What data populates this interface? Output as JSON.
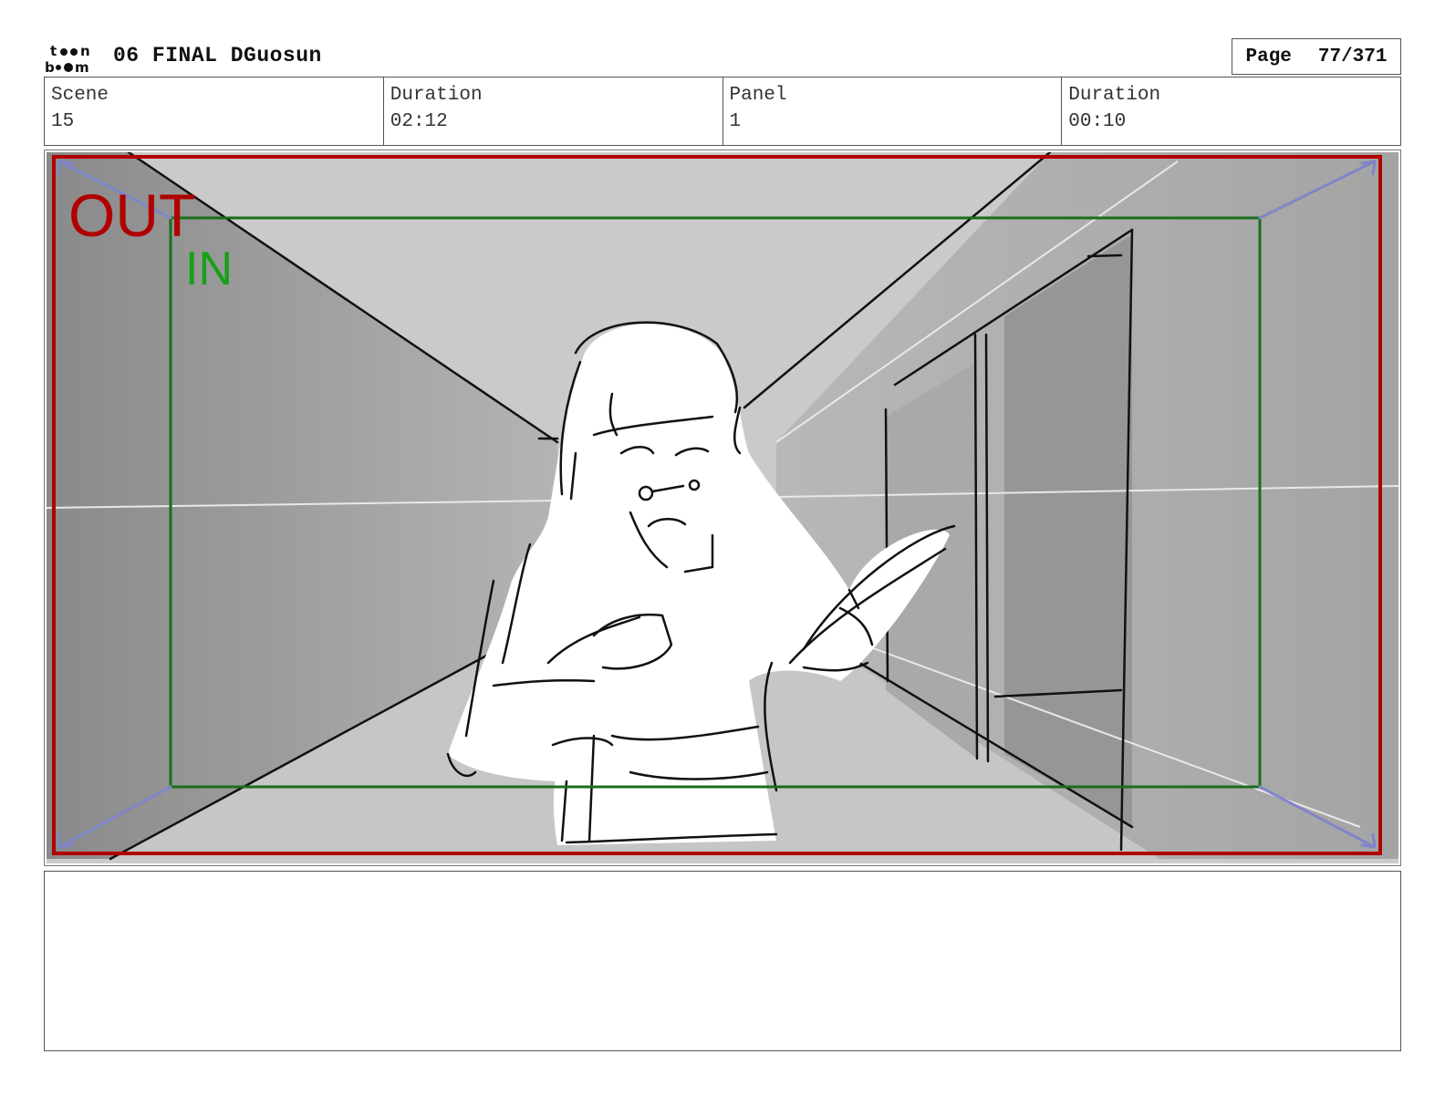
{
  "header": {
    "logo_text_top": "t●●n",
    "logo_text_bottom": "b●●m",
    "title": "06 FINAL DGuosun",
    "page_label": "Page",
    "page_value": "77/371"
  },
  "info": {
    "scene_label": "Scene",
    "scene_value": "15",
    "scene_duration_label": "Duration",
    "scene_duration_value": "02:12",
    "panel_label": "Panel",
    "panel_value": "1",
    "panel_duration_label": "Duration",
    "panel_duration_value": "00:10"
  },
  "frame": {
    "out_label": "OUT",
    "in_label": "IN",
    "out_color": "#b00000",
    "in_color": "#1a7a1a",
    "in_text_color": "#18a018"
  },
  "notes": {
    "text": ""
  }
}
